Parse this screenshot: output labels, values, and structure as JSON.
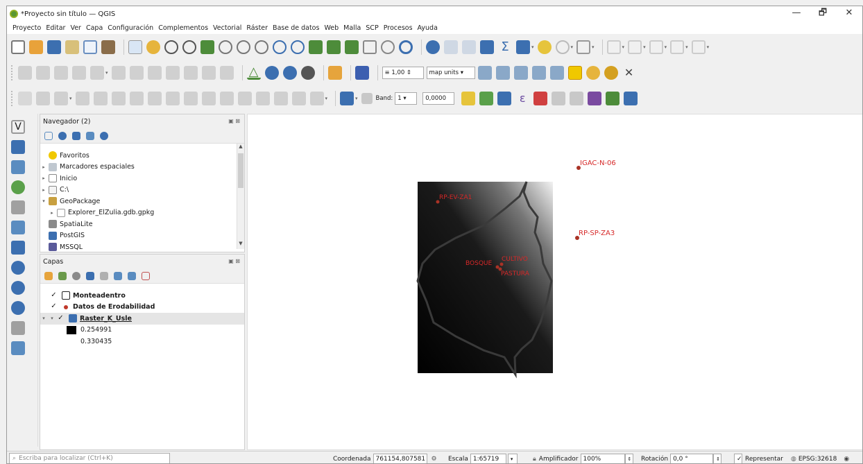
{
  "window": {
    "title": "*Proyecto sin título — QGIS",
    "min": "—",
    "max": "🗗",
    "close": "✕"
  },
  "menu": [
    "Proyecto",
    "Editar",
    "Ver",
    "Capa",
    "Configuración",
    "Complementos",
    "Vectorial",
    "Ráster",
    "Base de datos",
    "Web",
    "Malla",
    "SCP",
    "Procesos",
    "Ayuda"
  ],
  "toolbar2": {
    "width_value": "1,00",
    "units": "map units"
  },
  "toolbar3": {
    "band_label": "Band:",
    "band_value": "1",
    "value": "0,0000"
  },
  "navigator": {
    "title": "Navegador (2)",
    "items": [
      {
        "label": "Favoritos"
      },
      {
        "label": "Marcadores espaciales"
      },
      {
        "label": "Inicio"
      },
      {
        "label": "C:\\"
      },
      {
        "label": "GeoPackage"
      },
      {
        "label": "Explorer_ElZulia.gdb.gpkg"
      },
      {
        "label": "SpatiaLite"
      },
      {
        "label": "PostGIS"
      },
      {
        "label": "MSSQL"
      }
    ]
  },
  "layers": {
    "title": "Capas",
    "items": [
      {
        "label": "Monteadentro"
      },
      {
        "label": "Datos de Erodabilidad"
      },
      {
        "label": "Raster_K_Usle"
      }
    ],
    "legend": {
      "min": "0.254991",
      "max": "0.330435"
    }
  },
  "map": {
    "points": [
      {
        "label": "IGAC-N-06"
      },
      {
        "label": "RP-EV-ZA1"
      },
      {
        "label": "RP-SP-ZA3"
      },
      {
        "label": "BOSQUE"
      },
      {
        "label": "CULTIVO"
      },
      {
        "label": "PASTURA"
      }
    ],
    "label_color": "#d62828"
  },
  "status": {
    "locator_placeholder": "Escriba para localizar (Ctrl+K)",
    "coord_label": "Coordenada",
    "coord_value": "761154,807581",
    "scale_label": "Escala",
    "scale_value": "1:65719",
    "magnifier_label": "Amplificador",
    "magnifier_value": "100%",
    "rotation_label": "Rotación",
    "rotation_value": "0,0 °",
    "render_label": "Representar",
    "crs": "EPSG:32618"
  },
  "colors": {
    "accent": "#589632",
    "selection": "#e5e5e5"
  }
}
